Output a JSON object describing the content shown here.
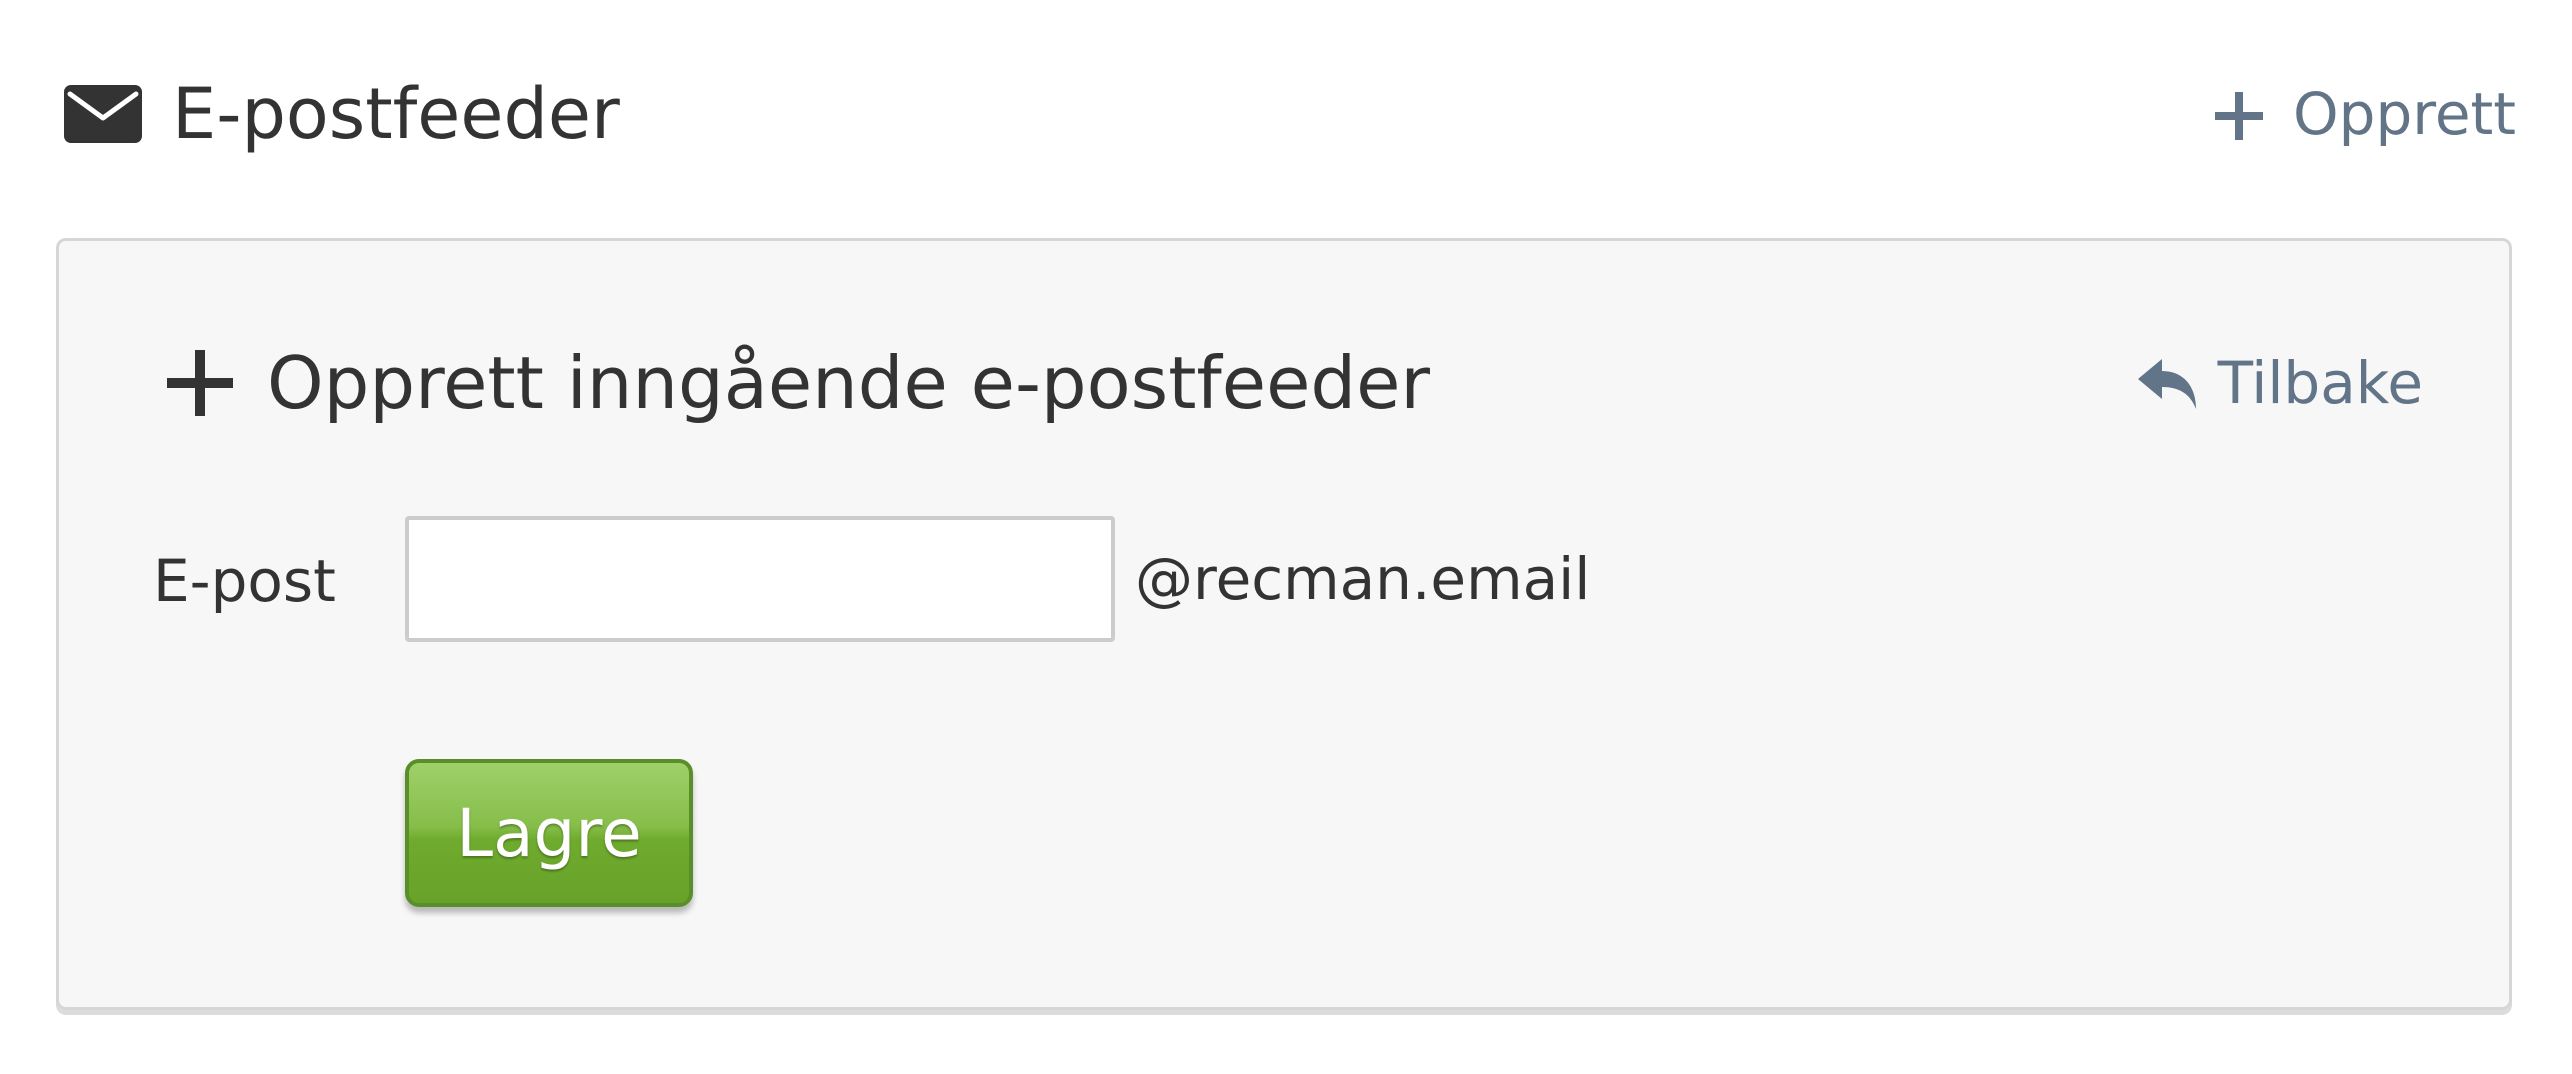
{
  "header": {
    "title": "E-postfeeder",
    "create_label": "Opprett",
    "icon": "envelope-icon"
  },
  "panel": {
    "title": "Opprett inngående e-postfeeder",
    "back_label": "Tilbake",
    "title_icon": "plus-icon",
    "back_icon": "reply-icon"
  },
  "form": {
    "email_label": "E-post",
    "email_value": "",
    "email_placeholder": "",
    "email_suffix": "@recman.email",
    "save_label": "Lagre"
  },
  "colors": {
    "link": "#627487",
    "text": "#333333",
    "panel_bg": "#f7f7f7",
    "button_green": "#7cb642"
  }
}
